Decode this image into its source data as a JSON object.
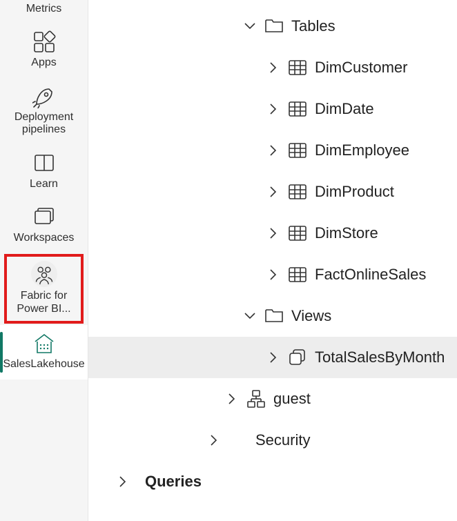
{
  "sidebar": {
    "items": [
      {
        "label": "Metrics"
      },
      {
        "label": "Apps"
      },
      {
        "label": "Deployment pipelines"
      },
      {
        "label": "Learn"
      },
      {
        "label": "Workspaces"
      },
      {
        "label": "Fabric for Power BI..."
      },
      {
        "label": "SalesLakehouse"
      }
    ]
  },
  "tree": {
    "tables": {
      "label": "Tables",
      "items": [
        {
          "label": "DimCustomer"
        },
        {
          "label": "DimDate"
        },
        {
          "label": "DimEmployee"
        },
        {
          "label": "DimProduct"
        },
        {
          "label": "DimStore"
        },
        {
          "label": "FactOnlineSales"
        }
      ]
    },
    "views": {
      "label": "Views",
      "items": [
        {
          "label": "TotalSalesByMonth"
        }
      ]
    },
    "guest": {
      "label": "guest"
    },
    "security": {
      "label": "Security"
    },
    "queries": {
      "label": "Queries"
    }
  }
}
